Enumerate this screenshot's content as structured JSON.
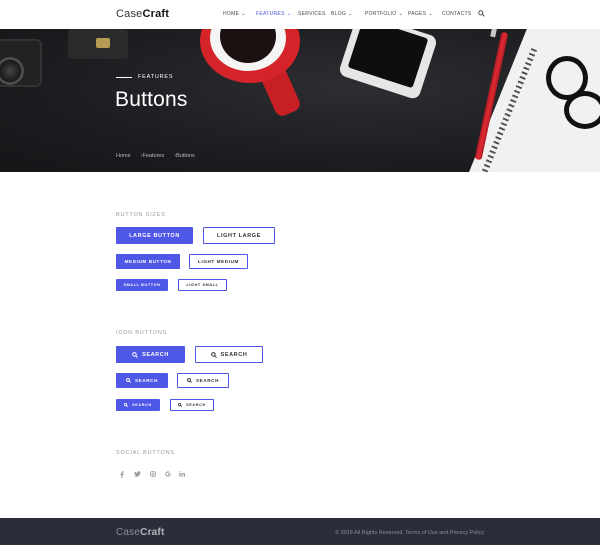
{
  "brand": {
    "light": "Case",
    "bold": "Craft"
  },
  "nav": {
    "items": [
      {
        "label": "HOME",
        "has_chevron": true
      },
      {
        "label": "FEATURES",
        "has_chevron": true,
        "active": true
      },
      {
        "label": "SERVICES",
        "has_chevron": false
      },
      {
        "label": "BLOG",
        "has_chevron": true
      },
      {
        "label": "PORTFOLIO",
        "has_chevron": true
      },
      {
        "label": "PAGES",
        "has_chevron": true
      },
      {
        "label": "CONTACTS",
        "has_chevron": false
      }
    ],
    "search_icon": "search-icon"
  },
  "hero": {
    "eyebrow": "FEATURES",
    "title": "Buttons",
    "breadcrumb": [
      "Home",
      "Features",
      "Buttons"
    ],
    "breadcrumb_separator": "›"
  },
  "sections": {
    "sizes": {
      "label": "BUTTON SIZES",
      "large_primary": "LARGE BUTTON",
      "large_light": "LIGHT LARGE",
      "medium_primary": "MEDIUM BUTTON",
      "medium_light": "LIGHT MEDIUM",
      "small_primary": "SMALL BUTTON",
      "small_light": "LIGHT SMALL"
    },
    "icon": {
      "label": "ICON BUTTONS",
      "search_label": "SEARCH",
      "icon_name": "search-icon"
    },
    "social": {
      "label": "SOCIAL BUTTONS",
      "icons": [
        "facebook-icon",
        "twitter-icon",
        "instagram-icon",
        "google-icon",
        "linkedin-icon"
      ]
    }
  },
  "footer": {
    "brand_light": "Case",
    "brand_bold": "Craft",
    "copyright": "© 2018 All Rights Reserved. Terms of Use and Privacy Policy"
  },
  "colors": {
    "accent": "#4f57e6",
    "footer_bg": "#2c2d3a",
    "hero_bg": "#1d1e21",
    "nav_active": "#4a55e0"
  }
}
